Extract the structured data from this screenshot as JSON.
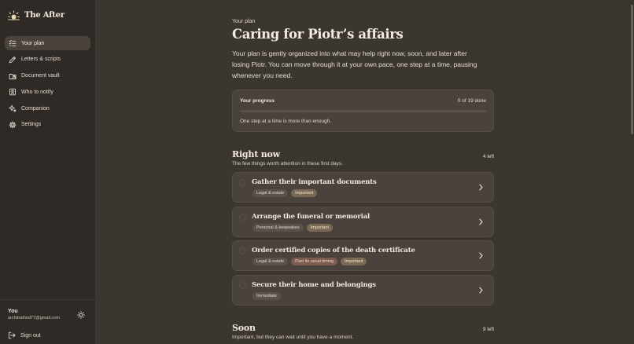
{
  "brand": {
    "name": "The After",
    "icon": "sunrise-icon"
  },
  "nav": [
    {
      "label": "Your plan",
      "icon": "checklist-icon",
      "active": true
    },
    {
      "label": "Letters & scripts",
      "icon": "pen-icon",
      "active": false
    },
    {
      "label": "Document vault",
      "icon": "folder-lock-icon",
      "active": false
    },
    {
      "label": "Who to notify",
      "icon": "contacts-icon",
      "active": false
    },
    {
      "label": "Companion",
      "icon": "sparkles-icon",
      "active": false
    },
    {
      "label": "Settings",
      "icon": "gear-icon",
      "active": false
    }
  ],
  "user": {
    "name": "You",
    "email": "architrathod77@gmail.com",
    "theme_icon": "sun-icon"
  },
  "signout": {
    "label": "Sign out",
    "icon": "logout-icon"
  },
  "page": {
    "eyebrow": "Your plan",
    "title": "Caring for Piotr’s affairs",
    "intro": "Your plan is gently organized into what may help right now, soon, and later after losing Piotr. You can move through it at your own pace, one step at a time, pausing whenever you need."
  },
  "progress": {
    "label": "Your progress",
    "count": "0 of 19 done",
    "done": 0,
    "total": 19,
    "note": "One step at a time is more than enough."
  },
  "sections": {
    "right_now": {
      "title": "Right now",
      "subtitle": "The few things worth attention in these first days.",
      "count": "4 left",
      "tasks": [
        {
          "title": "Gather their important documents",
          "tags": [
            {
              "label": "Legal & estate",
              "kind": "neutral"
            },
            {
              "label": "Important",
              "kind": "warm"
            }
          ]
        },
        {
          "title": "Arrange the funeral or memorial",
          "tags": [
            {
              "label": "Personal & keepsakes",
              "kind": "neutral"
            },
            {
              "label": "Important",
              "kind": "warm"
            }
          ]
        },
        {
          "title": "Order certified copies of the death certificate",
          "tags": [
            {
              "label": "Legal & estate",
              "kind": "neutral"
            },
            {
              "label": "Past its usual timing",
              "kind": "alert"
            },
            {
              "label": "Important",
              "kind": "warm"
            }
          ]
        },
        {
          "title": "Secure their home and belongings",
          "tags": [
            {
              "label": "Immediate",
              "kind": "neutral"
            }
          ]
        }
      ]
    },
    "soon": {
      "title": "Soon",
      "subtitle": "Important, but they can wait until you have a moment.",
      "count": "9 left"
    }
  },
  "colors": {
    "background": "#3c3631",
    "sidebar": "#2f2a26",
    "card": "#4a423c",
    "accent": "#d8c8a8"
  }
}
